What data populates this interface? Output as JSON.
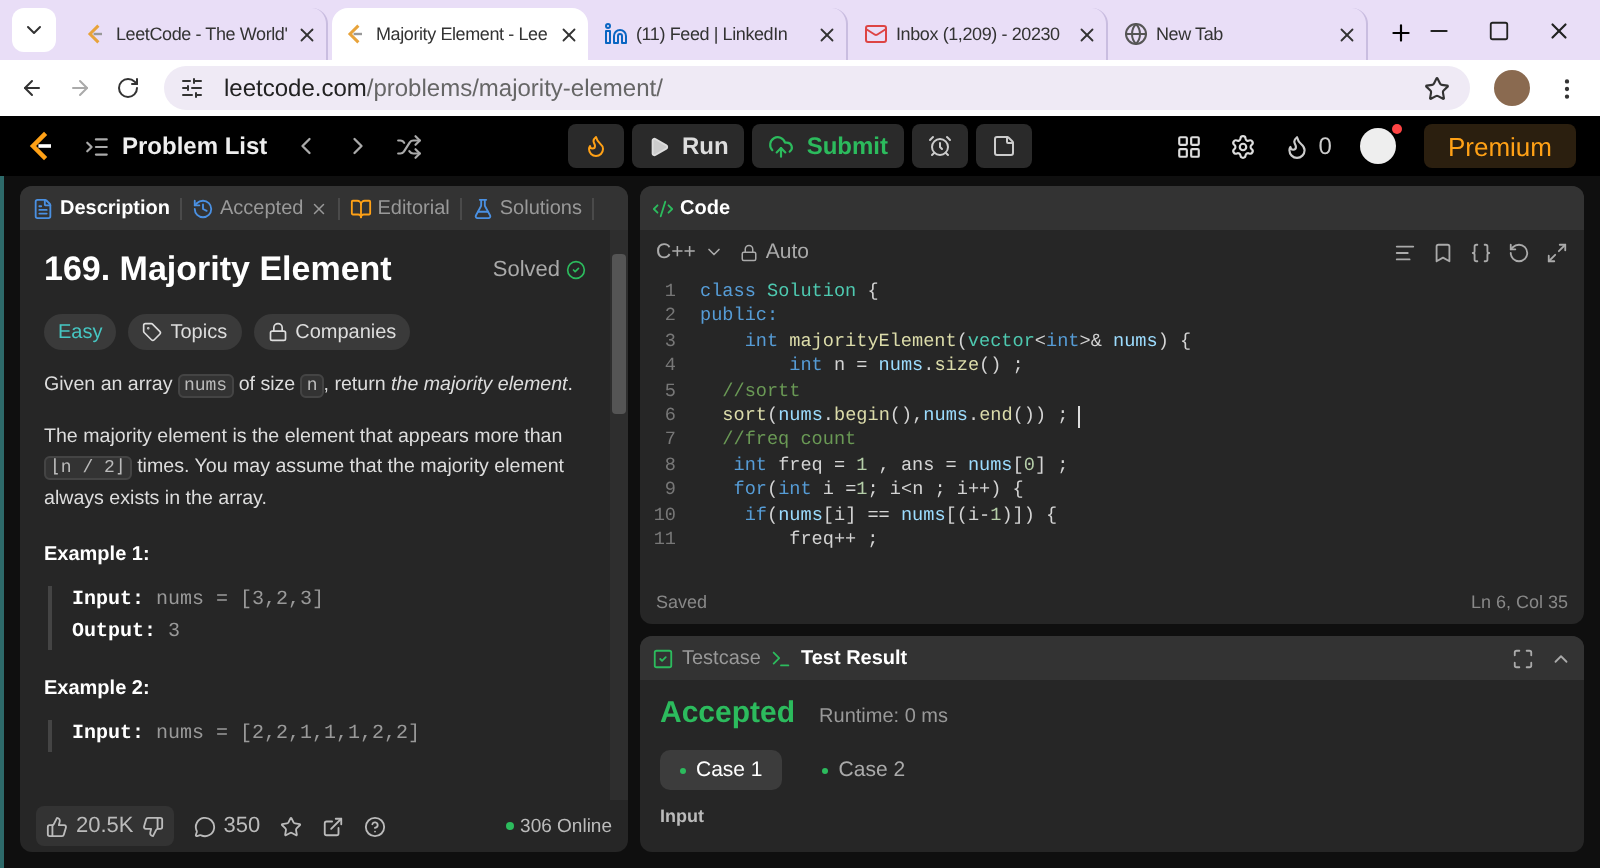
{
  "browser": {
    "tabs": [
      {
        "title": "LeetCode - The World'",
        "kind": "leetcode",
        "selected": false
      },
      {
        "title": "Majority Element - Lee",
        "kind": "leetcode",
        "selected": true
      },
      {
        "title": "(11) Feed | LinkedIn",
        "kind": "linkedin",
        "selected": false
      },
      {
        "title": "Inbox (1,209) - 20230",
        "kind": "mail",
        "selected": false
      },
      {
        "title": "New Tab",
        "kind": "chrome",
        "selected": false
      }
    ],
    "url": {
      "domain": "leetcode.com",
      "path": "/problems/majority-element/"
    }
  },
  "nav": {
    "problem_list": "Problem List",
    "run": "Run",
    "submit": "Submit",
    "streak": "0",
    "premium": "Premium"
  },
  "description": {
    "tabs": [
      {
        "label": "Description",
        "kind": "description",
        "selected": true,
        "closable": false
      },
      {
        "label": "Accepted",
        "kind": "accepted",
        "selected": false,
        "closable": true
      },
      {
        "label": "Editorial",
        "kind": "editorial",
        "selected": false,
        "closable": false
      },
      {
        "label": "Solutions",
        "kind": "solutions",
        "selected": false,
        "closable": false
      }
    ],
    "title": "169. Majority Element",
    "status": "Solved",
    "tags": [
      {
        "label": "Easy",
        "kind": "difficulty"
      },
      {
        "label": "Topics",
        "kind": "topics"
      },
      {
        "label": "Companies",
        "kind": "companies"
      }
    ],
    "paragraphs": [
      [
        {
          "kind": "text",
          "text": "Given an array "
        },
        {
          "kind": "code",
          "text": "nums"
        },
        {
          "kind": "text",
          "text": " of size "
        },
        {
          "kind": "code",
          "text": "n"
        },
        {
          "kind": "text",
          "text": ", return "
        },
        {
          "kind": "italic",
          "text": "the majority element"
        },
        {
          "kind": "text",
          "text": "."
        }
      ],
      [
        {
          "kind": "text",
          "text": "The majority element is the element that appears more than "
        },
        {
          "kind": "code",
          "text": "⌊n / 2⌋"
        },
        {
          "kind": "text",
          "text": " times. You may assume that the majority element always exists in the array."
        }
      ]
    ],
    "examples": [
      {
        "title": "Example 1:",
        "lines": [
          {
            "label": "Input:",
            "value": "nums = [3,2,3]"
          },
          {
            "label": "Output:",
            "value": "3"
          }
        ]
      },
      {
        "title": "Example 2:",
        "lines": [
          {
            "label": "Input:",
            "value": "nums = [2,2,1,1,1,2,2]"
          }
        ]
      }
    ],
    "footer": {
      "likes": "20.5K",
      "comments": "350",
      "online": "306 Online"
    }
  },
  "editor": {
    "title": "Code",
    "language": "C++",
    "mode": "Auto",
    "status": "Saved",
    "position": "Ln 6, Col 35",
    "lines": [
      {
        "number": "1",
        "cursor": false,
        "tokens": [
          {
            "kind": "kw",
            "text": "class"
          },
          {
            "kind": "type",
            "text": " Solution"
          },
          {
            "kind": "p",
            "text": " {"
          }
        ]
      },
      {
        "number": "2",
        "cursor": false,
        "tokens": [
          {
            "kind": "kw",
            "text": "public:"
          }
        ]
      },
      {
        "number": "3",
        "cursor": false,
        "tokens": [
          {
            "kind": "kw",
            "text": "    int"
          },
          {
            "kind": "fn",
            "text": " majorityElement"
          },
          {
            "kind": "p",
            "text": "("
          },
          {
            "kind": "type",
            "text": "vector"
          },
          {
            "kind": "p",
            "text": "<"
          },
          {
            "kind": "kw",
            "text": "int"
          },
          {
            "kind": "p",
            "text": ">& "
          },
          {
            "kind": "var",
            "text": "nums"
          },
          {
            "kind": "p",
            "text": ") {"
          }
        ]
      },
      {
        "number": "4",
        "cursor": false,
        "tokens": [
          {
            "kind": "kw",
            "text": "        int"
          },
          {
            "kind": "p",
            "text": " n = "
          },
          {
            "kind": "var",
            "text": "nums"
          },
          {
            "kind": "p",
            "text": "."
          },
          {
            "kind": "fn",
            "text": "size"
          },
          {
            "kind": "p",
            "text": "() ;"
          }
        ]
      },
      {
        "number": "5",
        "cursor": false,
        "tokens": [
          {
            "kind": "comment",
            "text": "  //sortt"
          }
        ]
      },
      {
        "number": "6",
        "cursor": true,
        "tokens": [
          {
            "kind": "fn",
            "text": "  sort"
          },
          {
            "kind": "p",
            "text": "("
          },
          {
            "kind": "var",
            "text": "nums"
          },
          {
            "kind": "p",
            "text": "."
          },
          {
            "kind": "fn",
            "text": "begin"
          },
          {
            "kind": "p",
            "text": "(),"
          },
          {
            "kind": "var",
            "text": "nums"
          },
          {
            "kind": "p",
            "text": "."
          },
          {
            "kind": "fn",
            "text": "end"
          },
          {
            "kind": "p",
            "text": "()) ;"
          }
        ]
      },
      {
        "number": "7",
        "cursor": false,
        "tokens": [
          {
            "kind": "comment",
            "text": "  //freq count"
          }
        ]
      },
      {
        "number": "8",
        "cursor": false,
        "tokens": [
          {
            "kind": "kw",
            "text": "   int"
          },
          {
            "kind": "p",
            "text": " freq = "
          },
          {
            "kind": "num",
            "text": "1"
          },
          {
            "kind": "p",
            "text": " , ans = "
          },
          {
            "kind": "var",
            "text": "nums"
          },
          {
            "kind": "p",
            "text": "["
          },
          {
            "kind": "num",
            "text": "0"
          },
          {
            "kind": "p",
            "text": "] ;"
          }
        ]
      },
      {
        "number": "9",
        "cursor": false,
        "tokens": [
          {
            "kind": "kw",
            "text": "   for"
          },
          {
            "kind": "p",
            "text": "("
          },
          {
            "kind": "kw",
            "text": "int"
          },
          {
            "kind": "p",
            "text": " i ="
          },
          {
            "kind": "num",
            "text": "1"
          },
          {
            "kind": "p",
            "text": "; i<n ; i++) {"
          }
        ]
      },
      {
        "number": "10",
        "cursor": false,
        "tokens": [
          {
            "kind": "kw",
            "text": "    if"
          },
          {
            "kind": "p",
            "text": "("
          },
          {
            "kind": "var",
            "text": "nums"
          },
          {
            "kind": "p",
            "text": "[i] == "
          },
          {
            "kind": "var",
            "text": "nums"
          },
          {
            "kind": "p",
            "text": "[(i-"
          },
          {
            "kind": "num",
            "text": "1"
          },
          {
            "kind": "p",
            "text": ")]) {"
          }
        ]
      },
      {
        "number": "11",
        "cursor": false,
        "tokens": [
          {
            "kind": "p",
            "text": "        freq++ ;"
          }
        ]
      }
    ]
  },
  "console": {
    "tabs": [
      {
        "label": "Testcase",
        "kind": "testcase",
        "selected": false
      },
      {
        "label": "Test Result",
        "kind": "result",
        "selected": true
      }
    ],
    "verdict": "Accepted",
    "runtime": "Runtime: 0 ms",
    "cases": [
      {
        "label": "Case 1",
        "selected": true
      },
      {
        "label": "Case 2",
        "selected": false
      }
    ],
    "section": "Input"
  }
}
